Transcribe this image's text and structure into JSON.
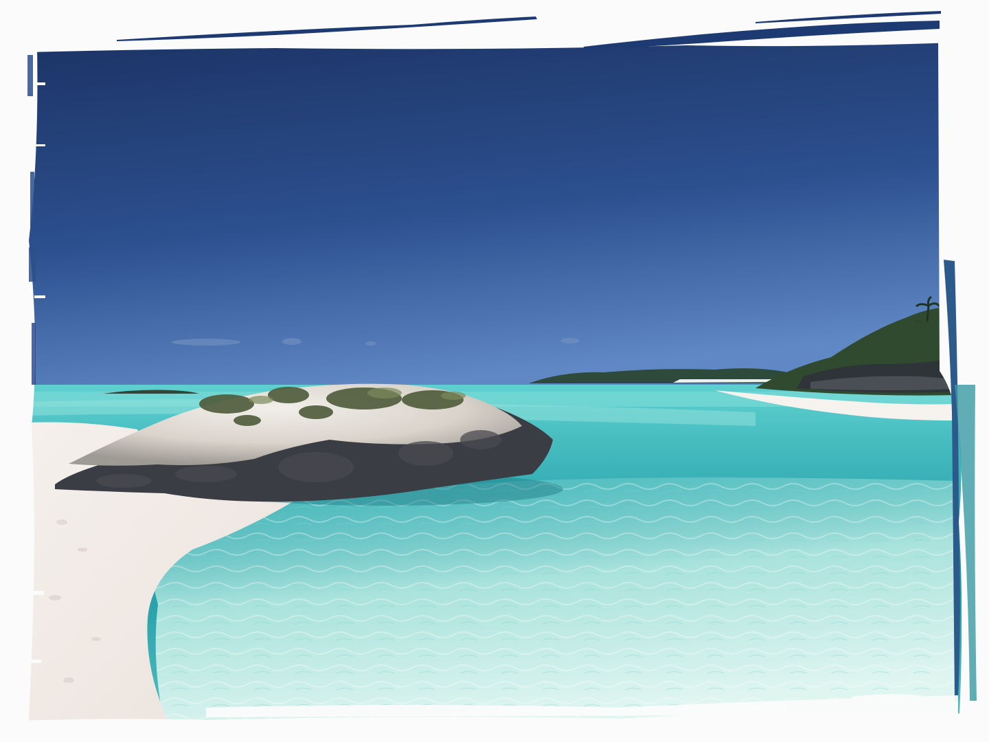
{
  "photo": {
    "subject": "beach-cove-scene",
    "colors": {
      "page_background": "#fbfbfb",
      "sky_top": "#1c3466",
      "sky_mid": "#2c4f8e",
      "sky_horizon": "#5f88c4",
      "sea_far": "#5fd0d0",
      "sea_deep": "#1f9aa5",
      "lagoon": "#54c1c2",
      "shallows": "#c8ede8",
      "sand": "#f2ebe6",
      "rock_dark": "#3b3d44",
      "rock_light": "#e8e3dc",
      "vegetation": "#4e5b3a",
      "brush_edge": "#1e3a73"
    }
  }
}
